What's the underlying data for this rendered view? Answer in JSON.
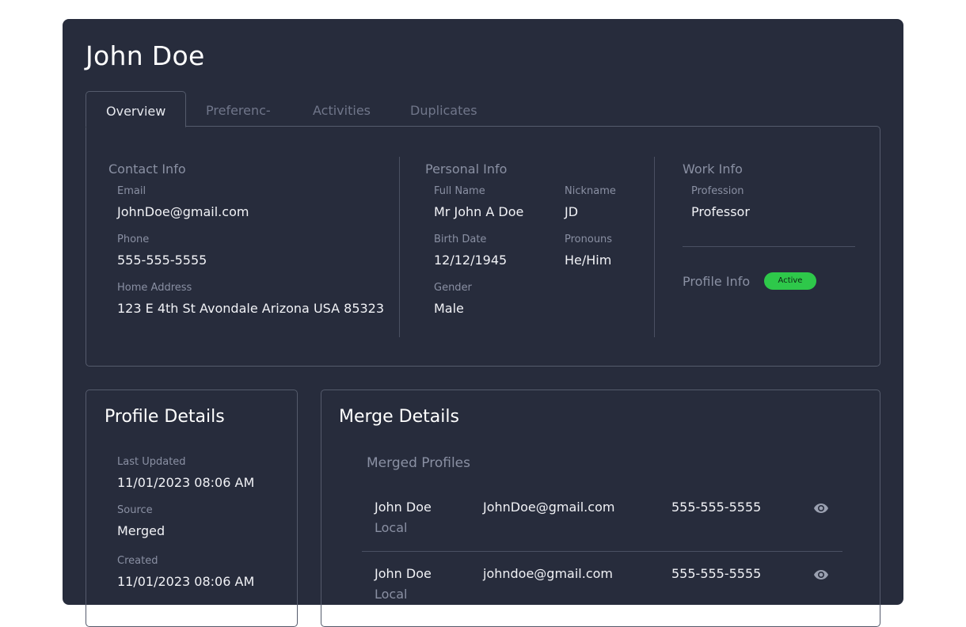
{
  "page": {
    "title": "John Doe"
  },
  "tabs": [
    {
      "label": "Overview",
      "active": true
    },
    {
      "label": "Preferenc-",
      "active": false
    },
    {
      "label": "Activities",
      "active": false
    },
    {
      "label": "Duplicates",
      "active": false
    }
  ],
  "contact_info": {
    "title": "Contact Info",
    "email_label": "Email",
    "email": "JohnDoe@gmail.com",
    "phone_label": "Phone",
    "phone": "555-555-5555",
    "address_label": "Home Address",
    "address": "123 E 4th St Avondale Arizona USA 85323"
  },
  "personal_info": {
    "title": "Personal Info",
    "full_name_label": "Full Name",
    "full_name": "Mr John A Doe",
    "nickname_label": "Nickname",
    "nickname": "JD",
    "birth_date_label": "Birth Date",
    "birth_date": "12/12/1945",
    "pronouns_label": "Pronouns",
    "pronouns": "He/Him",
    "gender_label": "Gender",
    "gender": "Male"
  },
  "work_info": {
    "title": "Work Info",
    "profession_label": "Profession",
    "profession": "Professor"
  },
  "profile_info": {
    "title": "Profile Info",
    "status": "Active",
    "status_color": "#2ec84a"
  },
  "profile_details": {
    "title": "Profile Details",
    "last_updated_label": "Last Updated",
    "last_updated": "11/01/2023 08:06 AM",
    "source_label": "Source",
    "source": "Merged",
    "created_label": "Created",
    "created": "11/01/2023 08:06 AM"
  },
  "merge_details": {
    "title": "Merge Details",
    "subtitle": "Merged Profiles",
    "rows": [
      {
        "name": "John Doe",
        "source": "Local",
        "email": "JohnDoe@gmail.com",
        "phone": "555-555-5555",
        "icon": "eye-icon"
      },
      {
        "name": "John Doe",
        "source": "Local",
        "email": "johndoe@gmail.com",
        "phone": "555-555-5555",
        "icon": "eye-icon"
      }
    ]
  },
  "colors": {
    "background": "#272c3c",
    "border": "#555b6c",
    "muted_text": "#8a90a3",
    "text": "#f1f2f6"
  }
}
